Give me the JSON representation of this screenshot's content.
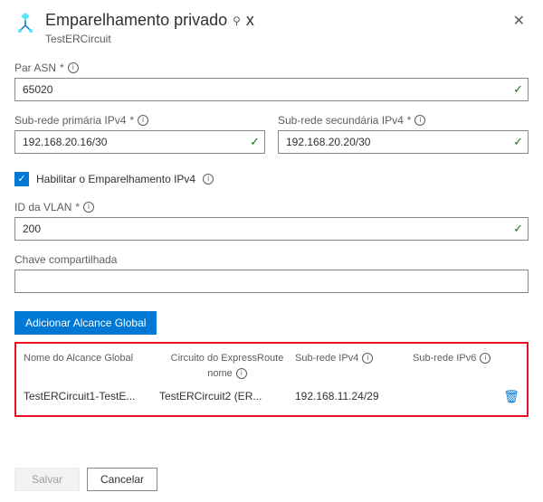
{
  "header": {
    "title": "Emparelhamento privado",
    "subtitle": "TestERCircuit"
  },
  "form": {
    "par_asn": {
      "label": "Par ASN",
      "value": "65020"
    },
    "subnet_primary": {
      "label": "Sub-rede primária IPv4",
      "value": "192.168.20.16/30"
    },
    "subnet_secondary": {
      "label": "Sub-rede secundária IPv4",
      "value": "192.168.20.20/30"
    },
    "enable_ipv4": {
      "label": "Habilitar o Emparelhamento IPv4",
      "checked": true
    },
    "vlan_id": {
      "label": "ID da VLAN",
      "value": "200"
    },
    "shared_key": {
      "label": "Chave compartilhada",
      "value": ""
    }
  },
  "actions": {
    "add_global": "Adicionar Alcance Global",
    "save": "Salvar",
    "cancel": "Cancelar"
  },
  "table": {
    "headers": {
      "name": "Nome do Alcance Global",
      "circuit_line1": "Circuito do ExpressRoute",
      "circuit_line2": "nome",
      "ipv4": "Sub-rede IPv4",
      "ipv6": "Sub-rede IPv6"
    },
    "rows": [
      {
        "name": "TestERCircuit1-TestE...",
        "circuit": "TestERCircuit2 (ER...",
        "ipv4": "192.168.11.24/29",
        "ipv6": ""
      }
    ]
  },
  "glyphs": {
    "check": "✓",
    "asterisk": "*",
    "info": "i",
    "x": "✕",
    "pin": "📌",
    "trash": "🗑"
  }
}
